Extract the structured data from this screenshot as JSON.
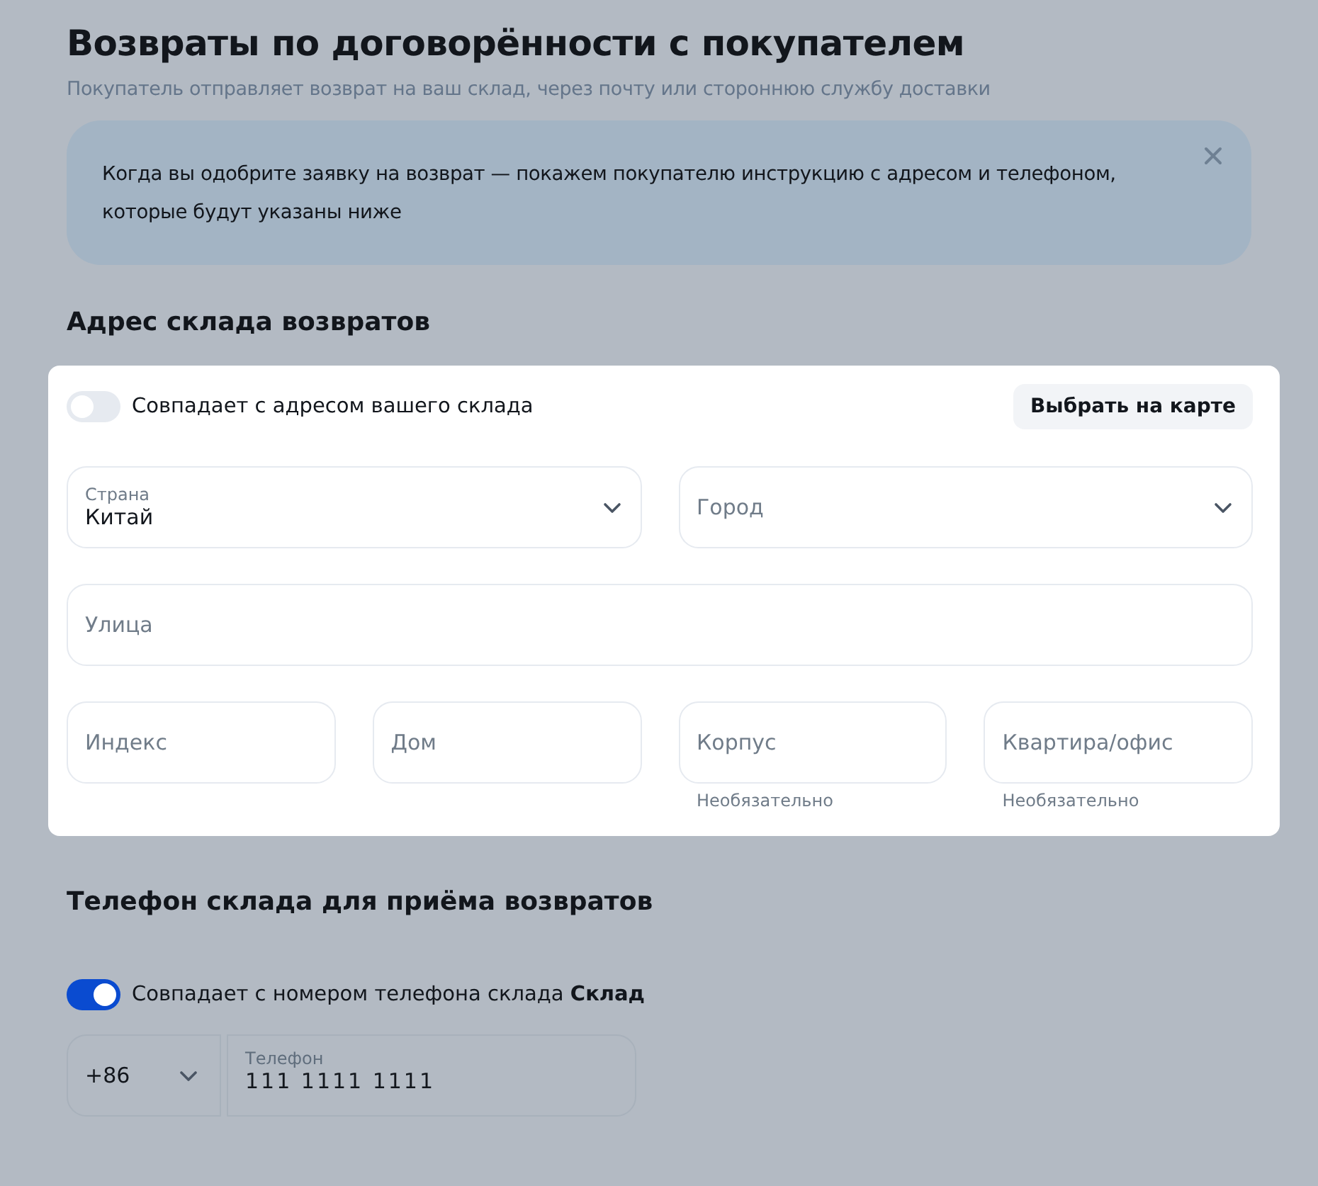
{
  "header": {
    "title": "Возвраты по договорённости с покупателем",
    "subtitle": "Покупатель отправляет возврат на ваш склад, через почту или стороннюю службу доставки"
  },
  "notice": {
    "text": "Когда вы одобрите заявку на возврат — покажем покупателю инструкцию с адресом и телефоном, которые будут указаны ниже"
  },
  "address": {
    "title": "Адрес склада возвратов",
    "toggle": {
      "label": "Совпадает с адресом вашего склада",
      "on": false
    },
    "map_button": "Выбрать на карте",
    "country": {
      "kind": "select",
      "label": "Страна",
      "value": "Китай"
    },
    "city": {
      "kind": "select",
      "placeholder": "Город"
    },
    "street": {
      "kind": "text",
      "placeholder": "Улица"
    },
    "postcode": {
      "kind": "text",
      "placeholder": "Индекс"
    },
    "house": {
      "kind": "text",
      "placeholder": "Дом"
    },
    "building": {
      "kind": "text",
      "placeholder": "Корпус",
      "hint": "Необязательно"
    },
    "apartment": {
      "kind": "text",
      "placeholder": "Квартира/офис",
      "hint": "Необязательно"
    }
  },
  "phone": {
    "title": "Телефон склада для приёма возвратов",
    "toggle": {
      "label": "Совпадает с номером телефона склада **Склад**",
      "on": true
    },
    "country_code": "+86",
    "field": {
      "label": "Телефон",
      "value": "111 1111 1111"
    }
  }
}
